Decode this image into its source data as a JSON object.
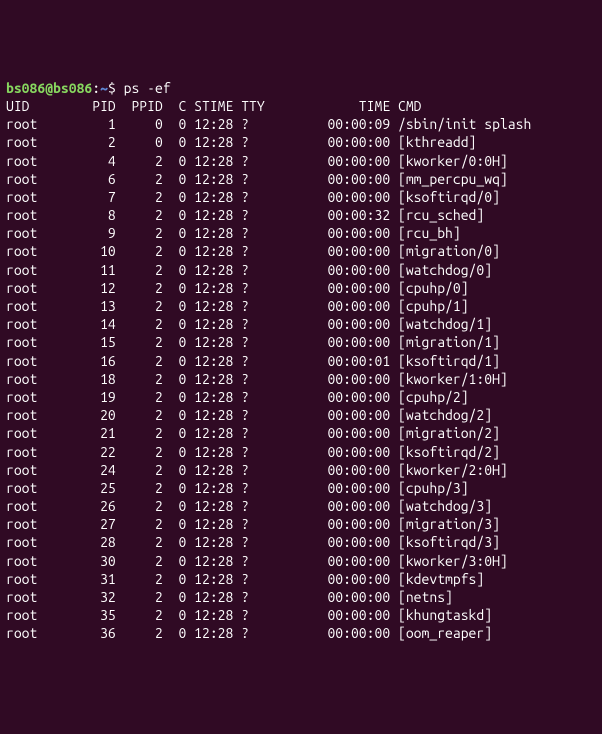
{
  "prompt": {
    "user": "bs086",
    "at": "@",
    "host": "bs086",
    "colon": ":",
    "path": "~",
    "dollar": "$ "
  },
  "command": "ps -ef",
  "header": {
    "uid": "UID",
    "pid": "PID",
    "ppid": "PPID",
    "c": "C",
    "stime": "STIME",
    "tty": "TTY",
    "time": "TIME",
    "cmd": "CMD"
  },
  "rows": [
    {
      "uid": "root",
      "pid": "1",
      "ppid": "0",
      "c": "0",
      "stime": "12:28",
      "tty": "?",
      "time": "00:00:09",
      "cmd": "/sbin/init splash"
    },
    {
      "uid": "root",
      "pid": "2",
      "ppid": "0",
      "c": "0",
      "stime": "12:28",
      "tty": "?",
      "time": "00:00:00",
      "cmd": "[kthreadd]"
    },
    {
      "uid": "root",
      "pid": "4",
      "ppid": "2",
      "c": "0",
      "stime": "12:28",
      "tty": "?",
      "time": "00:00:00",
      "cmd": "[kworker/0:0H]"
    },
    {
      "uid": "root",
      "pid": "6",
      "ppid": "2",
      "c": "0",
      "stime": "12:28",
      "tty": "?",
      "time": "00:00:00",
      "cmd": "[mm_percpu_wq]"
    },
    {
      "uid": "root",
      "pid": "7",
      "ppid": "2",
      "c": "0",
      "stime": "12:28",
      "tty": "?",
      "time": "00:00:00",
      "cmd": "[ksoftirqd/0]"
    },
    {
      "uid": "root",
      "pid": "8",
      "ppid": "2",
      "c": "0",
      "stime": "12:28",
      "tty": "?",
      "time": "00:00:32",
      "cmd": "[rcu_sched]"
    },
    {
      "uid": "root",
      "pid": "9",
      "ppid": "2",
      "c": "0",
      "stime": "12:28",
      "tty": "?",
      "time": "00:00:00",
      "cmd": "[rcu_bh]"
    },
    {
      "uid": "root",
      "pid": "10",
      "ppid": "2",
      "c": "0",
      "stime": "12:28",
      "tty": "?",
      "time": "00:00:00",
      "cmd": "[migration/0]"
    },
    {
      "uid": "root",
      "pid": "11",
      "ppid": "2",
      "c": "0",
      "stime": "12:28",
      "tty": "?",
      "time": "00:00:00",
      "cmd": "[watchdog/0]"
    },
    {
      "uid": "root",
      "pid": "12",
      "ppid": "2",
      "c": "0",
      "stime": "12:28",
      "tty": "?",
      "time": "00:00:00",
      "cmd": "[cpuhp/0]"
    },
    {
      "uid": "root",
      "pid": "13",
      "ppid": "2",
      "c": "0",
      "stime": "12:28",
      "tty": "?",
      "time": "00:00:00",
      "cmd": "[cpuhp/1]"
    },
    {
      "uid": "root",
      "pid": "14",
      "ppid": "2",
      "c": "0",
      "stime": "12:28",
      "tty": "?",
      "time": "00:00:00",
      "cmd": "[watchdog/1]"
    },
    {
      "uid": "root",
      "pid": "15",
      "ppid": "2",
      "c": "0",
      "stime": "12:28",
      "tty": "?",
      "time": "00:00:00",
      "cmd": "[migration/1]"
    },
    {
      "uid": "root",
      "pid": "16",
      "ppid": "2",
      "c": "0",
      "stime": "12:28",
      "tty": "?",
      "time": "00:00:01",
      "cmd": "[ksoftirqd/1]"
    },
    {
      "uid": "root",
      "pid": "18",
      "ppid": "2",
      "c": "0",
      "stime": "12:28",
      "tty": "?",
      "time": "00:00:00",
      "cmd": "[kworker/1:0H]"
    },
    {
      "uid": "root",
      "pid": "19",
      "ppid": "2",
      "c": "0",
      "stime": "12:28",
      "tty": "?",
      "time": "00:00:00",
      "cmd": "[cpuhp/2]"
    },
    {
      "uid": "root",
      "pid": "20",
      "ppid": "2",
      "c": "0",
      "stime": "12:28",
      "tty": "?",
      "time": "00:00:00",
      "cmd": "[watchdog/2]"
    },
    {
      "uid": "root",
      "pid": "21",
      "ppid": "2",
      "c": "0",
      "stime": "12:28",
      "tty": "?",
      "time": "00:00:00",
      "cmd": "[migration/2]"
    },
    {
      "uid": "root",
      "pid": "22",
      "ppid": "2",
      "c": "0",
      "stime": "12:28",
      "tty": "?",
      "time": "00:00:00",
      "cmd": "[ksoftirqd/2]"
    },
    {
      "uid": "root",
      "pid": "24",
      "ppid": "2",
      "c": "0",
      "stime": "12:28",
      "tty": "?",
      "time": "00:00:00",
      "cmd": "[kworker/2:0H]"
    },
    {
      "uid": "root",
      "pid": "25",
      "ppid": "2",
      "c": "0",
      "stime": "12:28",
      "tty": "?",
      "time": "00:00:00",
      "cmd": "[cpuhp/3]"
    },
    {
      "uid": "root",
      "pid": "26",
      "ppid": "2",
      "c": "0",
      "stime": "12:28",
      "tty": "?",
      "time": "00:00:00",
      "cmd": "[watchdog/3]"
    },
    {
      "uid": "root",
      "pid": "27",
      "ppid": "2",
      "c": "0",
      "stime": "12:28",
      "tty": "?",
      "time": "00:00:00",
      "cmd": "[migration/3]"
    },
    {
      "uid": "root",
      "pid": "28",
      "ppid": "2",
      "c": "0",
      "stime": "12:28",
      "tty": "?",
      "time": "00:00:00",
      "cmd": "[ksoftirqd/3]"
    },
    {
      "uid": "root",
      "pid": "30",
      "ppid": "2",
      "c": "0",
      "stime": "12:28",
      "tty": "?",
      "time": "00:00:00",
      "cmd": "[kworker/3:0H]"
    },
    {
      "uid": "root",
      "pid": "31",
      "ppid": "2",
      "c": "0",
      "stime": "12:28",
      "tty": "?",
      "time": "00:00:00",
      "cmd": "[kdevtmpfs]"
    },
    {
      "uid": "root",
      "pid": "32",
      "ppid": "2",
      "c": "0",
      "stime": "12:28",
      "tty": "?",
      "time": "00:00:00",
      "cmd": "[netns]"
    },
    {
      "uid": "root",
      "pid": "35",
      "ppid": "2",
      "c": "0",
      "stime": "12:28",
      "tty": "?",
      "time": "00:00:00",
      "cmd": "[khungtaskd]"
    },
    {
      "uid": "root",
      "pid": "36",
      "ppid": "2",
      "c": "0",
      "stime": "12:28",
      "tty": "?",
      "time": "00:00:00",
      "cmd": "[oom_reaper]"
    }
  ]
}
